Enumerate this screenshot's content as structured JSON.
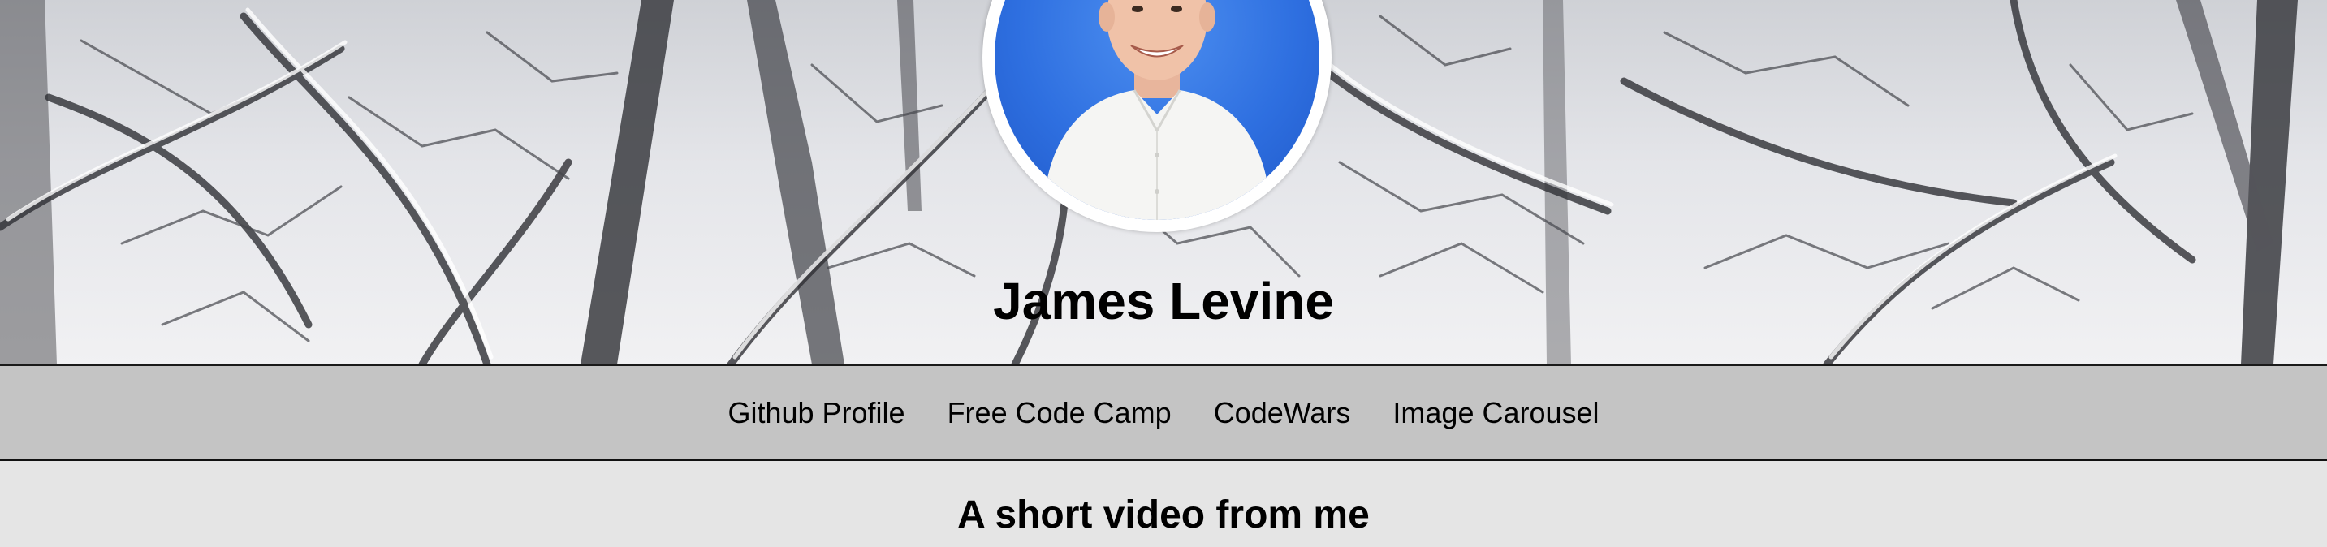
{
  "header": {
    "name": "James Levine",
    "background": "snowy-tree-branches-photo",
    "avatar": "profile-photo"
  },
  "nav": {
    "links": [
      {
        "label": "Github Profile"
      },
      {
        "label": "Free Code Camp"
      },
      {
        "label": "CodeWars"
      },
      {
        "label": "Image Carousel"
      }
    ]
  },
  "main": {
    "section_title": "A short video from me"
  },
  "colors": {
    "nav_background": "#c4c4c4",
    "page_background": "#e5e5e5",
    "avatar_backdrop": "#2e6fe0",
    "text": "#000000"
  }
}
